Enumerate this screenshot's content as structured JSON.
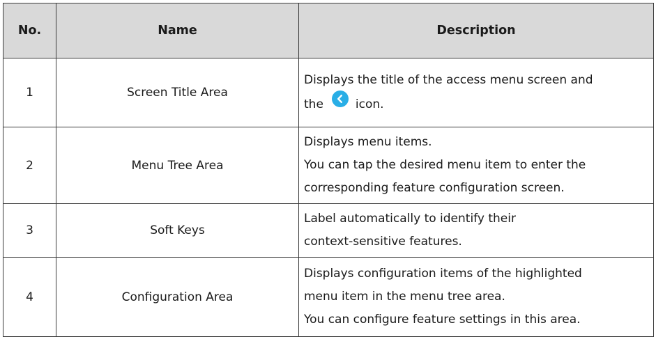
{
  "headers": {
    "no": "No.",
    "name": "Name",
    "description": "Description"
  },
  "rows": [
    {
      "no": "1",
      "name": "Screen Title Area",
      "description": [
        "Displays the title of the access menu screen and",
        "the",
        "icon."
      ],
      "icon": "back-chevron-icon",
      "icon_color": "#29aee6"
    },
    {
      "no": "2",
      "name": "Menu Tree Area",
      "description": [
        "Displays menu items.",
        "You can tap the desired menu item to enter the",
        "corresponding feature configuration screen."
      ]
    },
    {
      "no": "3",
      "name": "Soft Keys",
      "description": [
        "Label automatically to identify their",
        "context-sensitive features."
      ]
    },
    {
      "no": "4",
      "name": "Configuration Area",
      "description": [
        "Displays configuration items of the highlighted",
        "menu item in the menu tree area.",
        "You can configure feature settings in this area."
      ]
    }
  ],
  "colors": {
    "header_bg": "#d9d9d9",
    "border": "#3a3a3a",
    "text": "#1a1a1a"
  }
}
